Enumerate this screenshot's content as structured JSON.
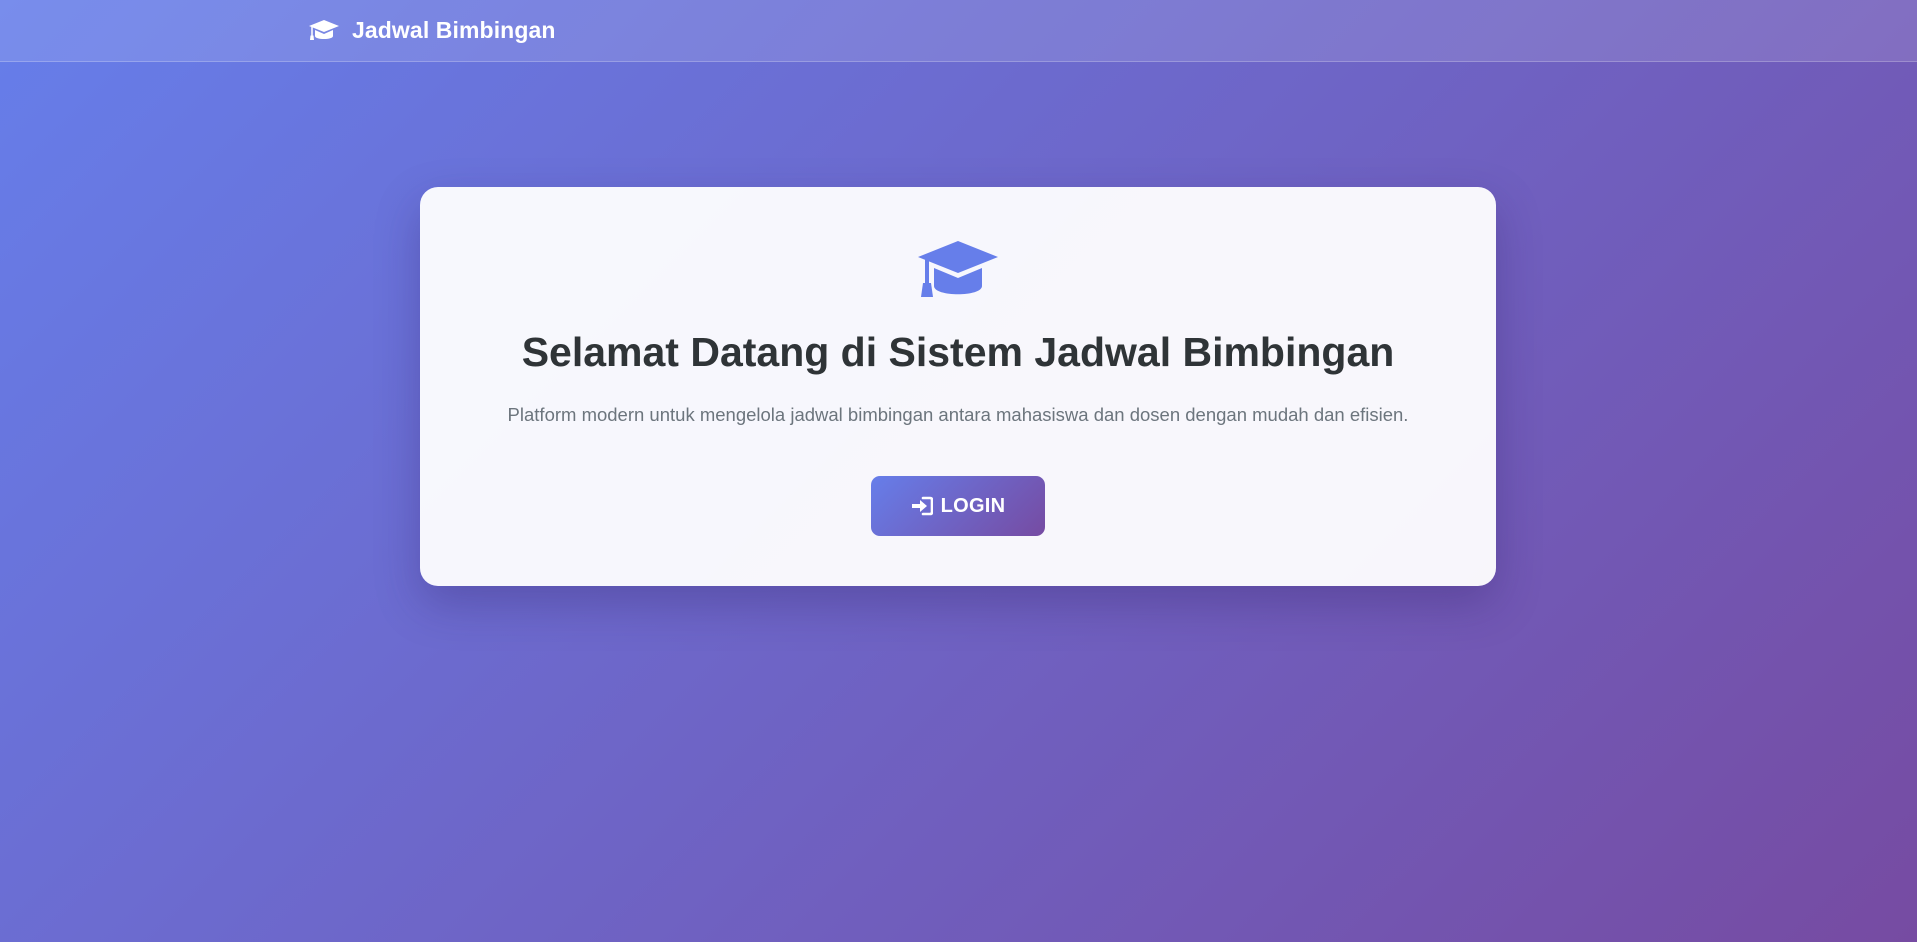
{
  "navbar": {
    "brand_icon": "graduation-cap-icon",
    "brand_title": "Jadwal Bimbingan"
  },
  "hero": {
    "icon": "graduation-cap-icon",
    "title": "Selamat Datang di Sistem Jadwal Bimbingan",
    "subtitle": "Platform modern untuk mengelola jadwal bimbingan antara mahasiswa dan dosen dengan mudah dan efisien.",
    "login_icon": "sign-in-icon",
    "login_label": "LOGIN"
  },
  "colors": {
    "gradient_start": "#667eea",
    "gradient_end": "#764ba2",
    "title_text": "#2f3437",
    "subtitle_text": "#6c757d"
  }
}
